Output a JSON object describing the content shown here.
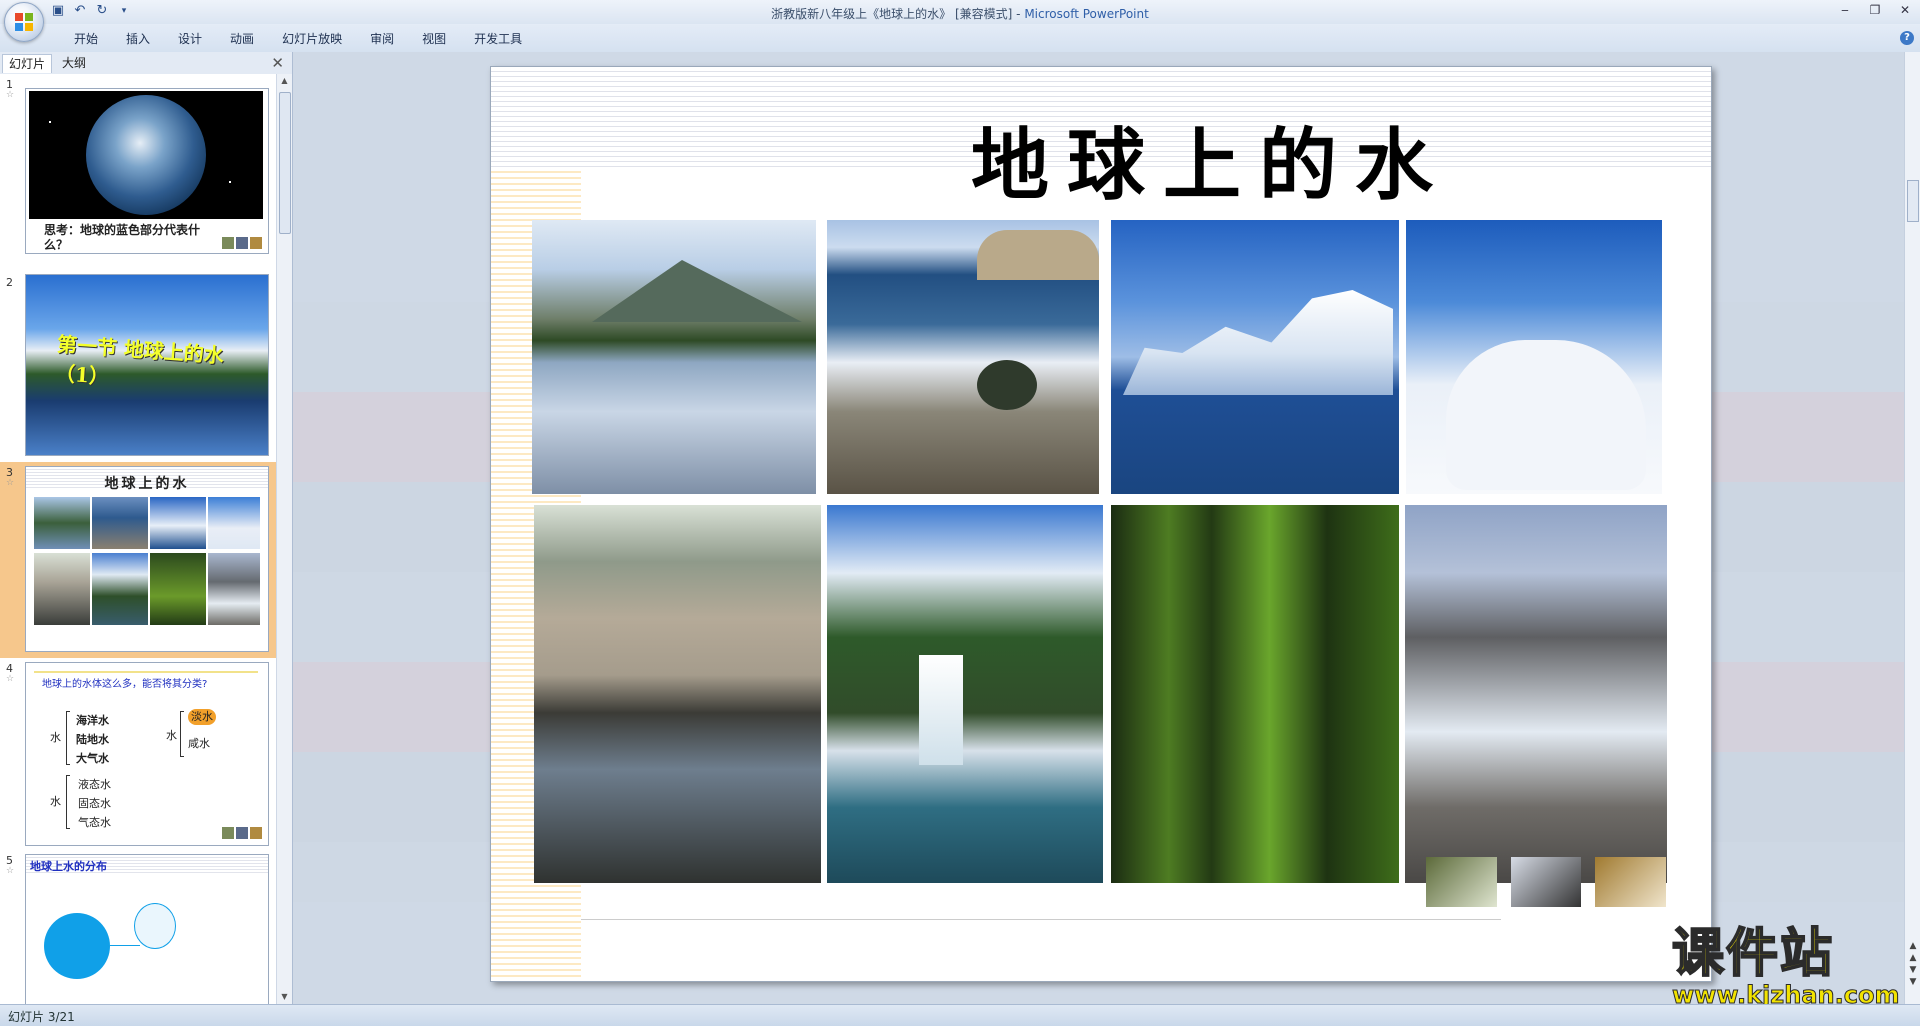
{
  "window": {
    "title": "浙教版新八年级上《地球上的水》 [兼容模式] -",
    "app_name": "Microsoft PowerPoint"
  },
  "ribbon": {
    "tabs": [
      "开始",
      "插入",
      "设计",
      "动画",
      "幻灯片放映",
      "审阅",
      "视图",
      "开发工具"
    ]
  },
  "panel": {
    "tab_slides": "幻灯片",
    "tab_outline": "大纲"
  },
  "thumbnails": [
    {
      "num": "1",
      "caption": "思考：地球的蓝色部分代表什么？"
    },
    {
      "num": "2",
      "title": "第一节 地球上的水（1）"
    },
    {
      "num": "3",
      "title": "地球上的水"
    },
    {
      "num": "4",
      "heading": "地球上的水体这么多，能否将其分类?",
      "col1_label": "水",
      "col1_items": [
        "海洋水",
        "陆地水",
        "大气水"
      ],
      "col2_label": "水",
      "col2_items": [
        "液态水",
        "固态水",
        "气态水"
      ],
      "col3_label": "水",
      "col3_items": [
        "淡水",
        "咸水"
      ]
    },
    {
      "num": "5",
      "heading": "地球上水的分布"
    }
  ],
  "slide": {
    "title": "地球上的水",
    "photos": [
      "mountain-lake",
      "ocean-shore",
      "iceberg",
      "clouds-sky",
      "spring-pool",
      "waterfall",
      "forest",
      "glacier"
    ]
  },
  "status": {
    "slide_counter": "幻灯片 3/21"
  },
  "watermark": {
    "text": "课件站",
    "url": "www.kjzhan.com"
  }
}
